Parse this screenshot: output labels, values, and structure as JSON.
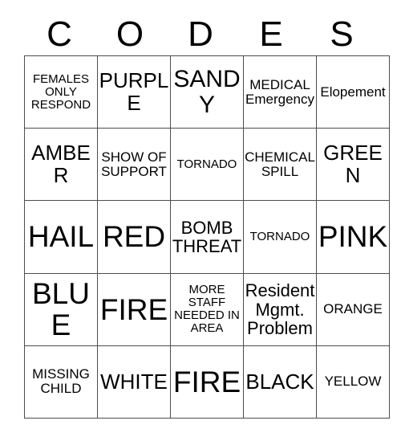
{
  "card": {
    "title_letters": [
      "C",
      "O",
      "D",
      "E",
      "S"
    ],
    "border_color": "#4d4d4d",
    "text_color": "#000000",
    "background_color": "#ffffff",
    "rows": [
      [
        {
          "text": "FEMALES ONLY RESPOND",
          "size": "fs-xs"
        },
        {
          "text": "PURPLE",
          "size": "fs-lg"
        },
        {
          "text": "SANDY",
          "size": "fs-xl"
        },
        {
          "text": "MEDICAL Emergency",
          "size": "fs-sm"
        },
        {
          "text": "Elopement",
          "size": "fs-sm"
        }
      ],
      [
        {
          "text": "AMBER",
          "size": "fs-lg"
        },
        {
          "text": "SHOW OF SUPPORT",
          "size": "fs-sm"
        },
        {
          "text": "TORNADO",
          "size": "fs-xs"
        },
        {
          "text": "CHEMICAL SPILL",
          "size": "fs-sm"
        },
        {
          "text": "GREEN",
          "size": "fs-lg"
        }
      ],
      [
        {
          "text": "HAIL",
          "size": "fs-xxl"
        },
        {
          "text": "RED",
          "size": "fs-xxl"
        },
        {
          "text": "BOMB THREAT",
          "size": "fs-md"
        },
        {
          "text": "TORNADO",
          "size": "fs-xs"
        },
        {
          "text": "PINK",
          "size": "fs-xxl"
        }
      ],
      [
        {
          "text": "BLUE",
          "size": "fs-xxl"
        },
        {
          "text": "FIRE",
          "size": "fs-xxl"
        },
        {
          "text": "MORE STAFF NEEDED IN AREA",
          "size": "fs-xs"
        },
        {
          "text": "Resident Mgmt. Problem",
          "size": "fs-md"
        },
        {
          "text": "ORANGE",
          "size": "fs-sm"
        }
      ],
      [
        {
          "text": "MISSING CHILD",
          "size": "fs-sm"
        },
        {
          "text": "WHITE",
          "size": "fs-lg"
        },
        {
          "text": "FIRE",
          "size": "fs-xxl"
        },
        {
          "text": "BLACK",
          "size": "fs-lg"
        },
        {
          "text": "YELLOW",
          "size": "fs-sm"
        }
      ]
    ]
  }
}
